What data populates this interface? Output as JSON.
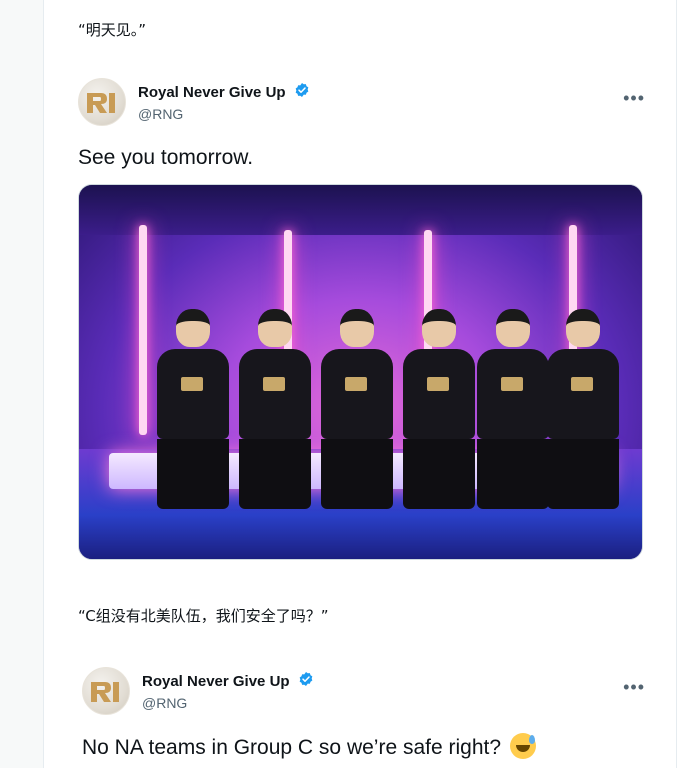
{
  "feed": {
    "items": [
      {
        "caption": "“明天见。”",
        "tweet": {
          "display_name": "Royal Never Give Up",
          "handle": "@RNG",
          "text": "See you tomorrow.",
          "has_media": true
        }
      },
      {
        "caption": "“C组没有北美队伍，我们安全了吗？”",
        "tweet": {
          "display_name": "Royal Never Give Up",
          "handle": "@RNG",
          "text": "No NA teams in Group C so we’re safe right?",
          "emoji": "sweat-smile-emoji"
        }
      }
    ]
  },
  "ui": {
    "more_label": "•••",
    "verified_color": "#1d9bf0"
  }
}
